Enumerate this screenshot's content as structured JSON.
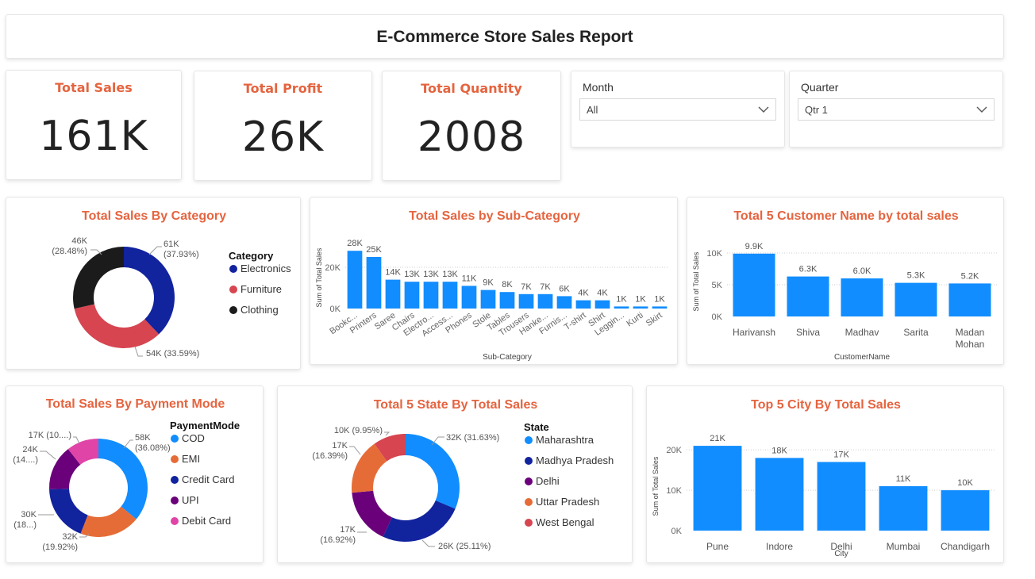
{
  "report": {
    "title": "E-Commerce Store Sales Report"
  },
  "kpis": [
    {
      "title": "Total Sales",
      "value": "161K"
    },
    {
      "title": "Total Profit",
      "value": "26K"
    },
    {
      "title": "Total Quantity",
      "value": "2008"
    }
  ],
  "slicers": {
    "month": {
      "label": "Month",
      "value": "All"
    },
    "quarter": {
      "label": "Quarter",
      "value": "Qtr 1"
    }
  },
  "colors": {
    "accent": "#e5643f",
    "bar": "#118dff"
  },
  "chart_data": [
    {
      "id": "category",
      "type": "pie",
      "donut": true,
      "title": "Total Sales By Category",
      "legend_title": "Category",
      "legend_position": "right",
      "slices": [
        {
          "name": "Electronics",
          "value": 61,
          "label": "61K",
          "pct": "(37.93%)",
          "color": "#12239e"
        },
        {
          "name": "Furniture",
          "value": 54,
          "label": "54K (33.59%)",
          "pct": "",
          "color": "#d64550"
        },
        {
          "name": "Clothing",
          "value": 46,
          "label": "46K",
          "pct": "(28.48%)",
          "color": "#1b1b1b"
        }
      ]
    },
    {
      "id": "subcategory",
      "type": "bar",
      "title": "Total Sales by Sub-Category",
      "xlabel": "Sub-Category",
      "ylabel": "Sum of Total Sales",
      "ylim": [
        0,
        30
      ],
      "yticks": [
        "0K",
        "20K"
      ],
      "ytick_values": [
        0,
        20
      ],
      "categories": [
        "Bookc...",
        "Printers",
        "Saree",
        "Chairs",
        "Electro...",
        "Access...",
        "Phones",
        "Stole",
        "Tables",
        "Trousers",
        "Hanke...",
        "Furnis...",
        "T-shirt",
        "Shirt",
        "Leggin...",
        "Kurti",
        "Skirt"
      ],
      "values": [
        28,
        25,
        14,
        13,
        13,
        13,
        11,
        9,
        8,
        7,
        7,
        6,
        4,
        4,
        1,
        1,
        1
      ],
      "labels": [
        "28K",
        "25K",
        "14K",
        "13K",
        "13K",
        "13K",
        "11K",
        "9K",
        "8K",
        "7K",
        "7K",
        "6K",
        "4K",
        "4K",
        "1K",
        "1K",
        "1K"
      ],
      "grid": true
    },
    {
      "id": "customers",
      "type": "bar",
      "title": "Total 5 Customer Name by total sales",
      "xlabel": "CustomerName",
      "ylabel": "Sum of Total Sales",
      "ylim": [
        0,
        11
      ],
      "yticks": [
        "0K",
        "5K",
        "10K"
      ],
      "ytick_values": [
        0,
        5,
        10
      ],
      "categories": [
        "Harivansh",
        "Shiva",
        "Madhav",
        "Sarita",
        "Madan Mohan"
      ],
      "values": [
        9.9,
        6.3,
        6.0,
        5.3,
        5.2
      ],
      "labels": [
        "9.9K",
        "6.3K",
        "6.0K",
        "5.3K",
        "5.2K"
      ],
      "grid": true
    },
    {
      "id": "payment",
      "type": "pie",
      "donut": true,
      "title": "Total Sales By Payment Mode",
      "legend_title": "PaymentMode",
      "legend_position": "right",
      "slices": [
        {
          "name": "COD",
          "value": 58,
          "label": "58K",
          "pct": "(36.08%)",
          "color": "#118dff"
        },
        {
          "name": "EMI",
          "value": 32,
          "label": "32K",
          "pct": "(19.92%)",
          "color": "#e66c37"
        },
        {
          "name": "Credit Card",
          "value": 30,
          "label": "30K",
          "pct": "(18...)",
          "color": "#12239e"
        },
        {
          "name": "UPI",
          "value": 24,
          "label": "24K",
          "pct": "(14....)",
          "color": "#6b007b"
        },
        {
          "name": "Debit Card",
          "value": 17,
          "label": "17K (10....)",
          "pct": "",
          "color": "#e044a7"
        }
      ]
    },
    {
      "id": "state",
      "type": "pie",
      "donut": true,
      "title": "Total 5 State By Total Sales",
      "legend_title": "State",
      "legend_position": "right",
      "slices": [
        {
          "name": "Maharashtra",
          "value": 32,
          "label": "32K (31.63%)",
          "pct": "",
          "color": "#118dff"
        },
        {
          "name": "Madhya Pradesh",
          "value": 26,
          "label": "26K (25.11%)",
          "pct": "",
          "color": "#12239e"
        },
        {
          "name": "Delhi",
          "value": 17,
          "label": "17K",
          "pct": "(16.92%)",
          "color": "#6b007b"
        },
        {
          "name": "Uttar Pradesh",
          "value": 17,
          "label": "17K",
          "pct": "(16.39%)",
          "color": "#e66c37"
        },
        {
          "name": "West Bengal",
          "value": 10,
          "label": "10K (9.95%)",
          "pct": "",
          "color": "#d64550"
        }
      ]
    },
    {
      "id": "city",
      "type": "bar",
      "title": "Top 5 City By Total Sales",
      "xlabel": "City",
      "ylabel": "Sum of Total Sales",
      "ylim": [
        0,
        22
      ],
      "yticks": [
        "0K",
        "10K",
        "20K"
      ],
      "ytick_values": [
        0,
        10,
        20
      ],
      "categories": [
        "Pune",
        "Indore",
        "Delhi",
        "Mumbai",
        "Chandigarh"
      ],
      "values": [
        21,
        18,
        17,
        11,
        10
      ],
      "labels": [
        "21K",
        "18K",
        "17K",
        "11K",
        "10K"
      ],
      "grid": true
    }
  ]
}
